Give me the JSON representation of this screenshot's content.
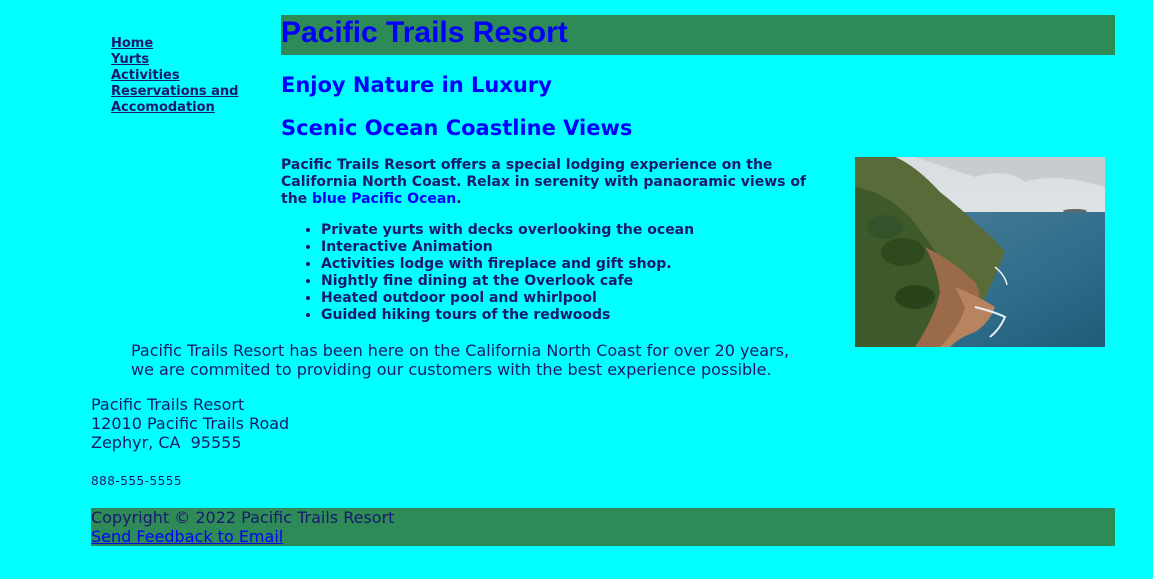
{
  "nav": {
    "items": [
      {
        "label": "Home"
      },
      {
        "label": "Yurts"
      },
      {
        "label": "Activities"
      },
      {
        "label": "Reservations and"
      },
      {
        "label": "Accomodation"
      }
    ]
  },
  "header": {
    "title": "Pacific Trails Resort"
  },
  "main": {
    "tagline": "Enjoy Nature in Luxury",
    "subheading": "Scenic Ocean Coastline Views",
    "intro_part1": "Pacific Trails Resort offers a special lodging experience on the California North Coast. Relax in serenity with panaoramic views of the ",
    "intro_highlight": "blue Pacific Ocean",
    "intro_part2": ".",
    "features": [
      "Private yurts with decks overlooking the ocean",
      "Interactive Animation",
      "Activities lodge with fireplace and gift shop.",
      "Nightly fine dining at the Overlook cafe",
      "Heated outdoor pool and whirlpool",
      "Guided hiking tours of the redwoods"
    ],
    "history": "Pacific Trails Resort has been here on the California North Coast for over 20 years, we are commited to providing our customers with the best experience possible."
  },
  "address": {
    "name": "Pacific Trails Resort",
    "street": "12010 Pacific Trails Road",
    "city": "Zephyr, CA  95555"
  },
  "phone": "888-555-5555",
  "footer": {
    "copyright": "Copyright © 2022 Pacific Trails Resort",
    "feedback_link": "Send Feedback to Email"
  },
  "colors": {
    "background": "#00FFFF",
    "banner": "#2E8B57",
    "heading": "#0000FF",
    "text": "#191970"
  }
}
